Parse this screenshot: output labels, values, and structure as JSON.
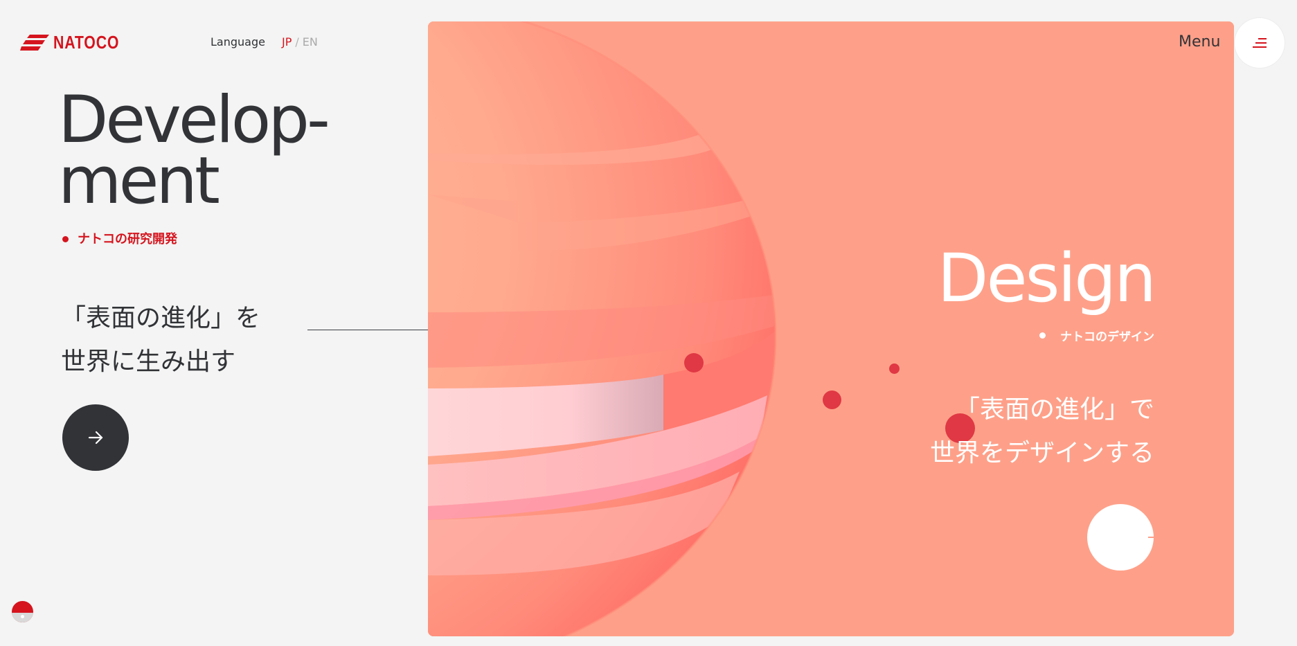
{
  "brand": {
    "name": "NATOCO",
    "color": "#d5141e"
  },
  "header": {
    "language_label": "Language",
    "lang_jp": "JP",
    "lang_separator": "/",
    "lang_en": "EN",
    "menu_label": "Menu",
    "menu_icon": "menu-icon"
  },
  "left": {
    "title_line1": "Develop-",
    "title_line2": "ment",
    "subtitle": "ナトコの研究開発",
    "catch_line1": "「表面の進化」を",
    "catch_line2": "世界に生み出す",
    "arrow_icon": "arrow-right-icon"
  },
  "panel": {
    "title": "Design",
    "subtitle": "ナトコのデザイン",
    "catch_line1": "「表面の進化」で",
    "catch_line2": "世界をデザインする",
    "background_color": "#fea089",
    "accent_dot_color": "#e03844"
  },
  "colors": {
    "page_background": "#f3f4f3",
    "text_dark": "#323337",
    "accent": "#d5141e"
  }
}
